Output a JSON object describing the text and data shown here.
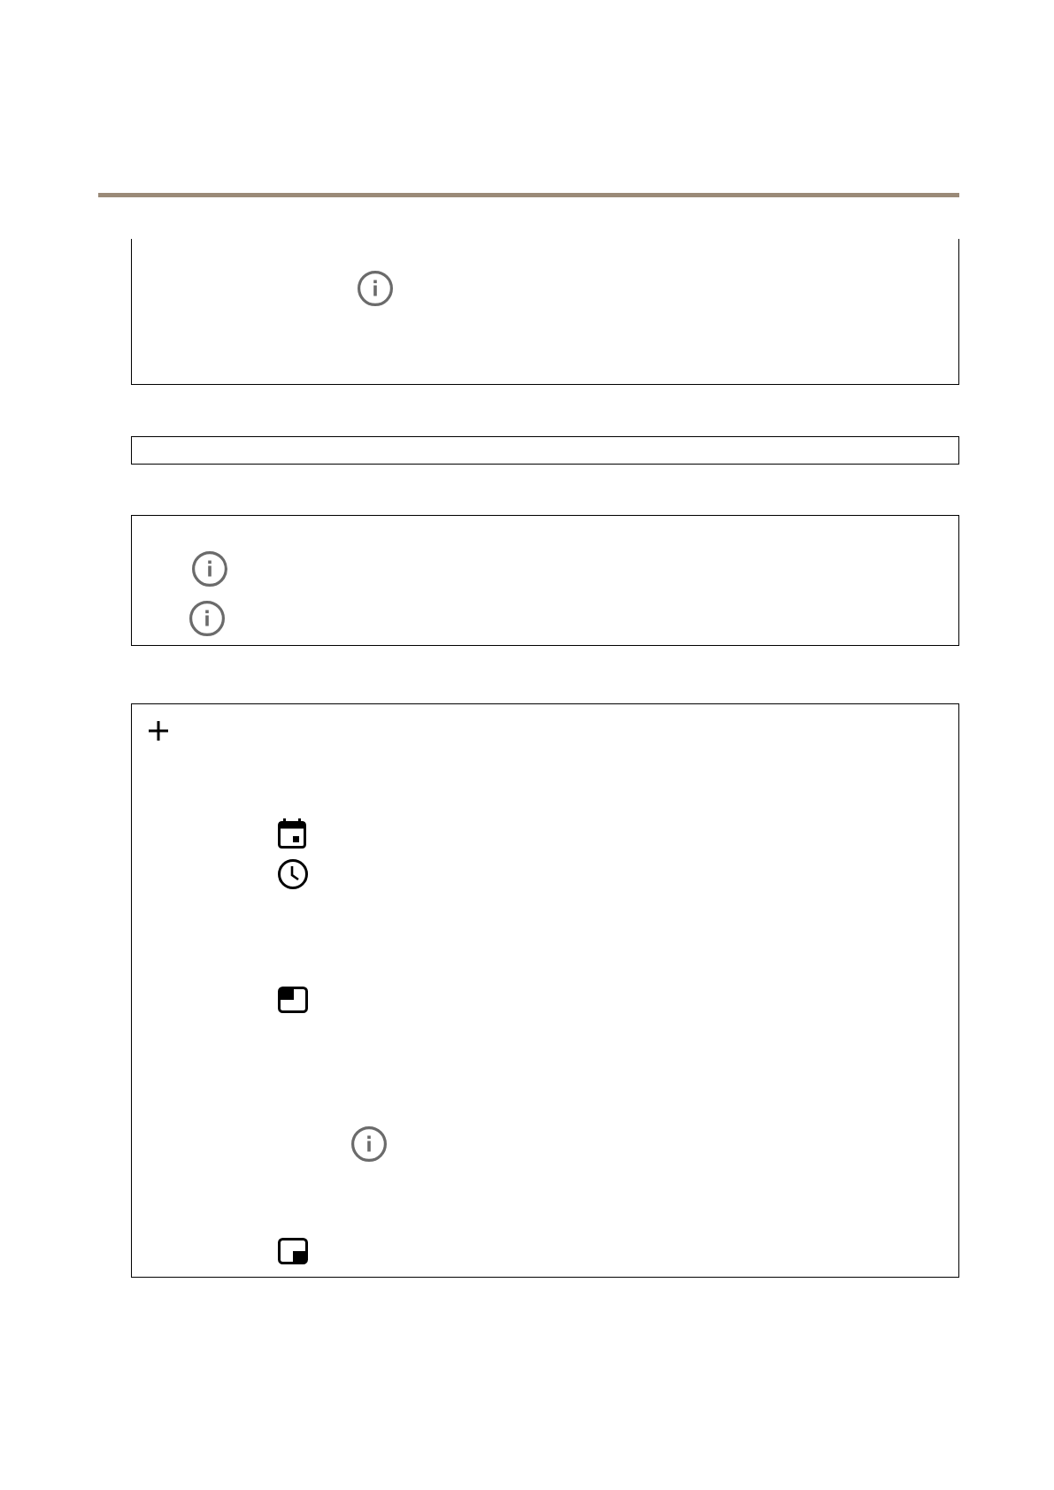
{
  "panels": [
    {
      "continued": true,
      "icons": [
        {
          "kind": "info"
        }
      ]
    },
    {
      "continued": false
    },
    {
      "continued": false,
      "icons": [
        {
          "kind": "info"
        },
        {
          "kind": "info"
        }
      ]
    },
    {
      "continued": false,
      "icons": [
        {
          "kind": "plus"
        },
        {
          "kind": "calendar"
        },
        {
          "kind": "clock"
        },
        {
          "kind": "topleft"
        },
        {
          "kind": "info"
        },
        {
          "kind": "bottomright"
        }
      ]
    }
  ]
}
